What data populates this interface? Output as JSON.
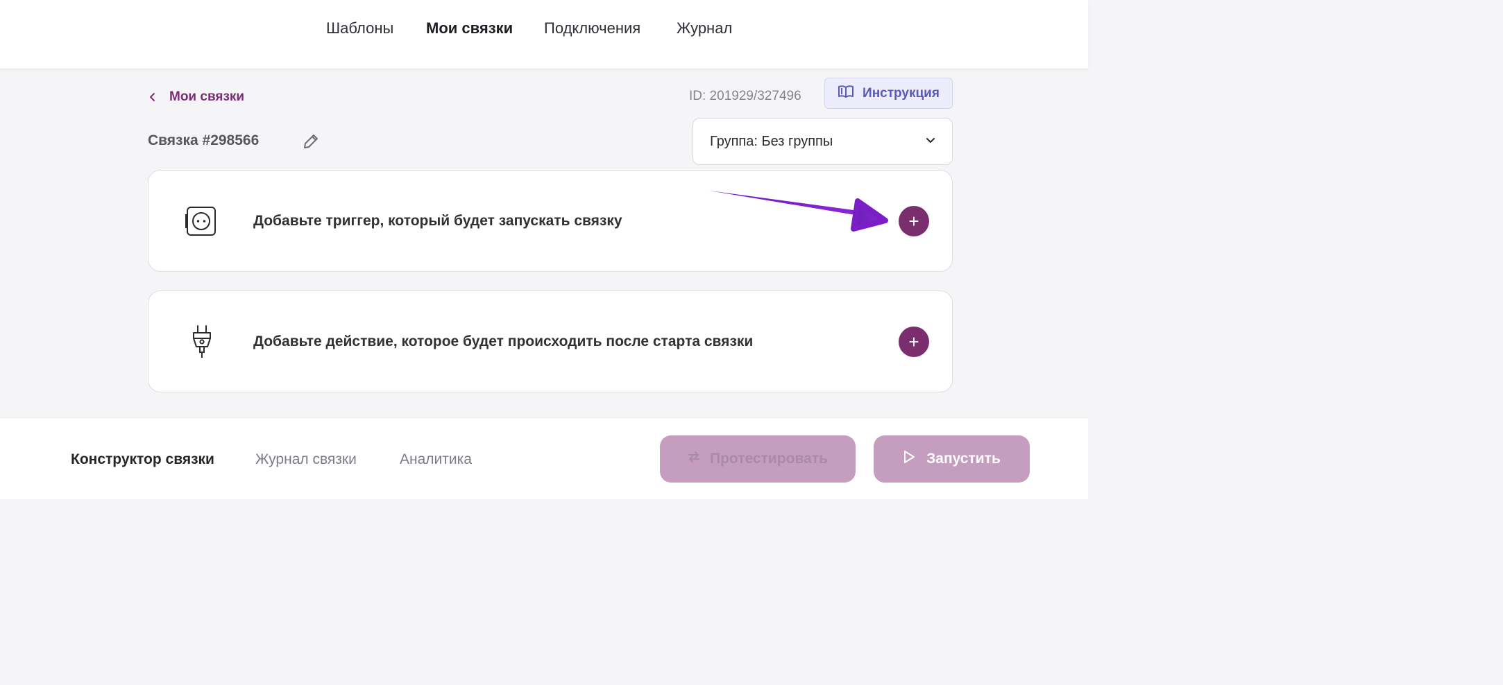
{
  "topnav": {
    "items": [
      {
        "label": "Шаблоны",
        "active": false
      },
      {
        "label": "Мои связки",
        "active": true
      },
      {
        "label": "Подключения",
        "active": false
      },
      {
        "label": "Журнал",
        "active": false
      }
    ]
  },
  "breadcrumb": {
    "back_label": "Мои связки"
  },
  "meta": {
    "id_text": "ID: 201929/327496"
  },
  "instruction_button": {
    "label": "Инструкция",
    "icon": "book-icon"
  },
  "page_title": "Связка #298566",
  "group_select": {
    "value": "Группа: Без группы"
  },
  "cards": [
    {
      "text": "Добавьте триггер, который будет запускать связку",
      "icon": "socket-icon",
      "button": "+"
    },
    {
      "text": "Добавьте действие, которое будет происходить после старта связки",
      "icon": "plug-icon",
      "button": "+"
    }
  ],
  "bottom_tabs": [
    {
      "label": "Конструктор связки",
      "active": true
    },
    {
      "label": "Журнал связки",
      "active": false
    },
    {
      "label": "Аналитика",
      "active": false
    }
  ],
  "actions": {
    "test_label": "Протестировать",
    "run_label": "Запустить"
  },
  "colors": {
    "brand": "#7a2e6e",
    "accent_arrow": "#7a1fc8",
    "button_disabled": "#c59dbf",
    "instruction_bg": "#ececfb"
  }
}
